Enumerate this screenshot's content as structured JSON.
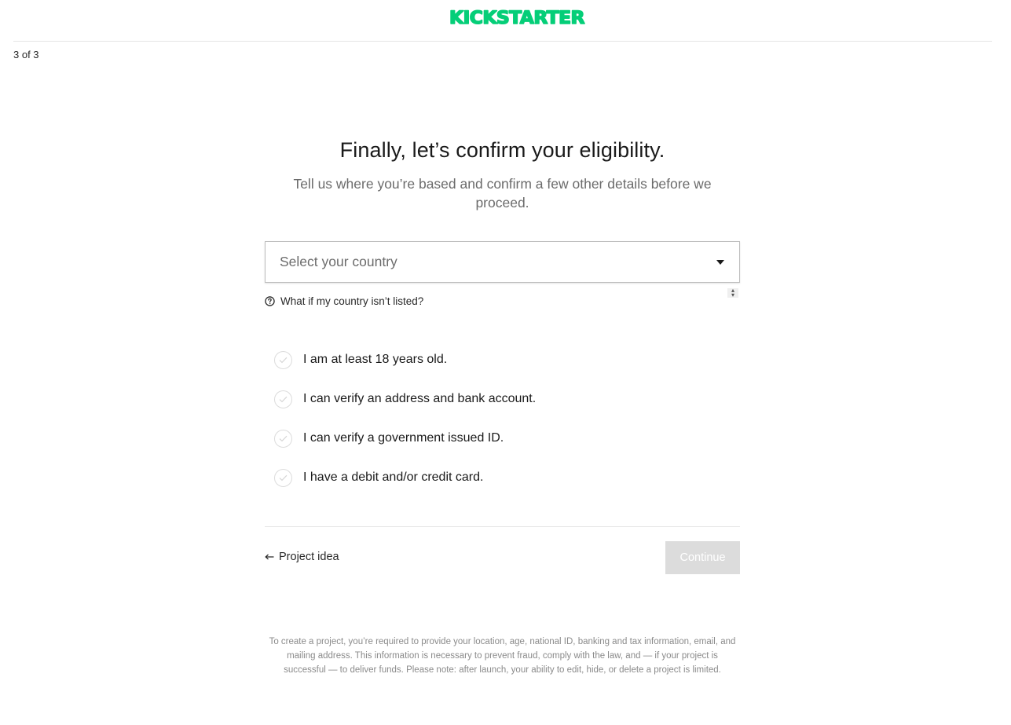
{
  "header": {
    "logo_text": "KICKSTARTER",
    "brand_color": "#05ce78",
    "step_indicator": "3 of 3"
  },
  "main": {
    "title": "Finally, let’s confirm your eligibility.",
    "subtitle": "Tell us where you’re based and confirm a few other details before we proceed.",
    "country_select": {
      "placeholder": "Select your country",
      "icon": "chevron-down-icon"
    },
    "help_link": {
      "label": "What if my country isn’t listed?",
      "icon": "question-circle-icon"
    },
    "checklist": [
      {
        "label": "I am at least 18 years old."
      },
      {
        "label": "I can verify an address and bank account."
      },
      {
        "label": "I can verify a government issued ID."
      },
      {
        "label": "I have a debit and/or credit card."
      }
    ]
  },
  "footer_nav": {
    "back_label": "Project idea",
    "back_icon": "arrow-left-icon",
    "continue_label": "Continue"
  },
  "disclaimer": "To create a project, you’re required to provide your location, age, national ID, banking and tax information, email, and mailing address. This information is necessary to prevent fraud, comply with the law, and — if your project is successful — to deliver funds. Please note: after launch, your ability to edit, hide, or delete a project is limited."
}
